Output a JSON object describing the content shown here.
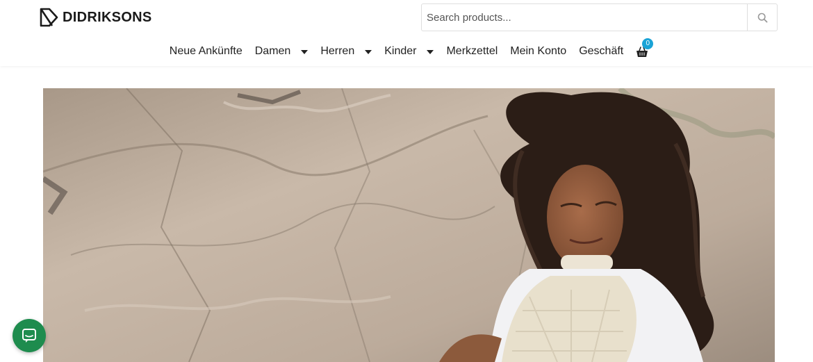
{
  "brand": {
    "name": "DIDRIKSONS",
    "logo_icon": "didriksons-logo-icon"
  },
  "search": {
    "placeholder": "Search products...",
    "value": "",
    "icon": "search-icon"
  },
  "nav": {
    "items": [
      {
        "label": "Neue Ankünfte",
        "has_dropdown": false
      },
      {
        "label": "Damen",
        "has_dropdown": true
      },
      {
        "label": "Herren",
        "has_dropdown": true
      },
      {
        "label": "Kinder",
        "has_dropdown": true
      },
      {
        "label": "Merkzettel",
        "has_dropdown": false
      },
      {
        "label": "Mein Konto",
        "has_dropdown": false
      },
      {
        "label": "Geschäft",
        "has_dropdown": false
      }
    ],
    "cart": {
      "icon": "shopping-basket-icon",
      "count": "0"
    }
  },
  "hero": {
    "image": "woman-with-curly-hair-in-quilted-vest-on-rocks"
  },
  "chat": {
    "icon": "chat-bubble-icon"
  },
  "colors": {
    "badge": "#1aa3d6",
    "chat": "#1e8c4e",
    "text": "#222222"
  }
}
